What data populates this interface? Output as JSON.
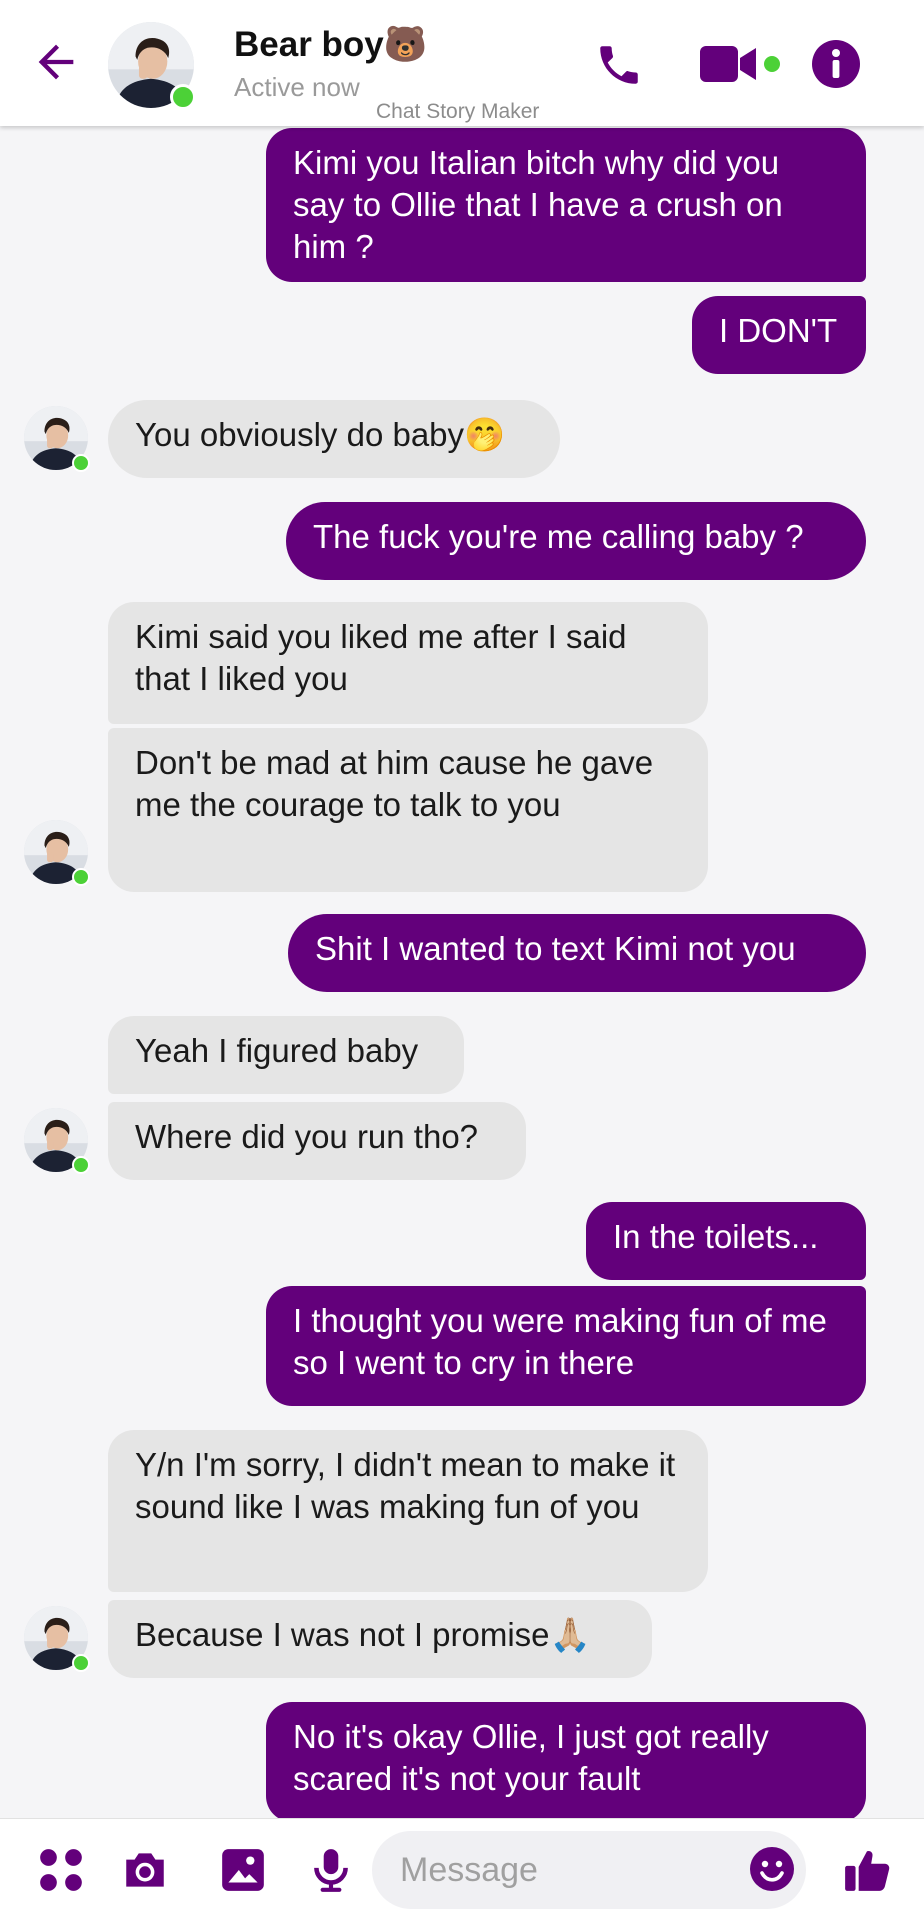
{
  "header": {
    "name": "Bear boy🐻",
    "status": "Active now",
    "watermark": "Chat Story Maker"
  },
  "messages": [
    {
      "side": "out",
      "text": "Kimi you Italian bitch why did you say to Ollie that I have a crush on him ?"
    },
    {
      "side": "out",
      "text": "I DON'T"
    },
    {
      "side": "in",
      "text": "You obviously do baby🤭"
    },
    {
      "side": "out",
      "text": "The fuck you're me calling baby ?"
    },
    {
      "side": "in",
      "text": "Kimi said you liked me after I said that I liked you"
    },
    {
      "side": "in",
      "text": "Don't be mad at him cause he gave me the courage to talk to you"
    },
    {
      "side": "out",
      "text": "Shit I wanted to text Kimi not you"
    },
    {
      "side": "in",
      "text": "Yeah I figured baby"
    },
    {
      "side": "in",
      "text": "Where did you run tho?"
    },
    {
      "side": "out",
      "text": "In the toilets..."
    },
    {
      "side": "out",
      "text": "I thought you were making fun of me so I went to cry in there"
    },
    {
      "side": "in",
      "text": "Y/n I'm sorry, I didn't mean to make it sound like I was making fun of you"
    },
    {
      "side": "in",
      "text": "Because I was not I promise🙏🏼"
    },
    {
      "side": "out",
      "text": "No it's okay Ollie, I just got really scared it's not your fault"
    }
  ],
  "composer": {
    "placeholder": "Message"
  },
  "colors": {
    "accent": "#63007b",
    "incoming_bubble": "#e5e5e5",
    "online": "#4cd137",
    "background": "#f5f5f7"
  },
  "icons": [
    "back-arrow-icon",
    "phone-icon",
    "video-camera-icon",
    "info-icon",
    "apps-grid-icon",
    "camera-icon",
    "gallery-icon",
    "microphone-icon",
    "smiley-icon",
    "thumbs-up-icon"
  ]
}
